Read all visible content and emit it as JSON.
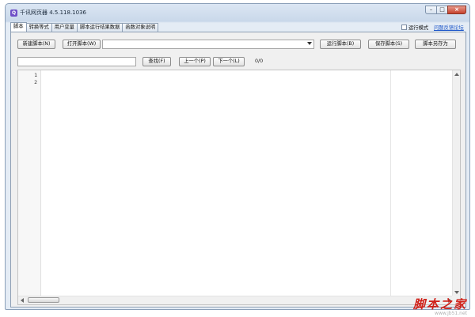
{
  "window": {
    "title": "千讯网页器 4.5.118.1036",
    "app_icon": "Q"
  },
  "tabs": [
    {
      "label": "脚本",
      "active": true
    },
    {
      "label": "转换等式",
      "active": false
    },
    {
      "label": "用户变量",
      "active": false
    },
    {
      "label": "脚本运行结果数据",
      "active": false
    },
    {
      "label": "函数对象说明",
      "active": false
    }
  ],
  "options": {
    "run_mode_label": "运行模式",
    "run_mode_checked": false,
    "forum_link": "问题反馈论坛"
  },
  "toolbar": {
    "new_script": "新建脚本(N)",
    "open_script": "打开脚本(W)",
    "script_select_value": "",
    "run_script": "运行脚本(B)",
    "save_script": "保存脚本(S)",
    "save_as": "脚本另存为"
  },
  "search": {
    "value": "",
    "find": "查找(F)",
    "prev": "上一个(P)",
    "next": "下一个(L)",
    "count": "0/0"
  },
  "editor": {
    "line_numbers": [
      "1",
      "2"
    ]
  },
  "watermark": {
    "main": "脚本之家",
    "sub": "www.jb51.net"
  },
  "icons": {
    "minimize": "minimize-icon",
    "maximize": "maximize-icon",
    "close": "close-icon"
  }
}
